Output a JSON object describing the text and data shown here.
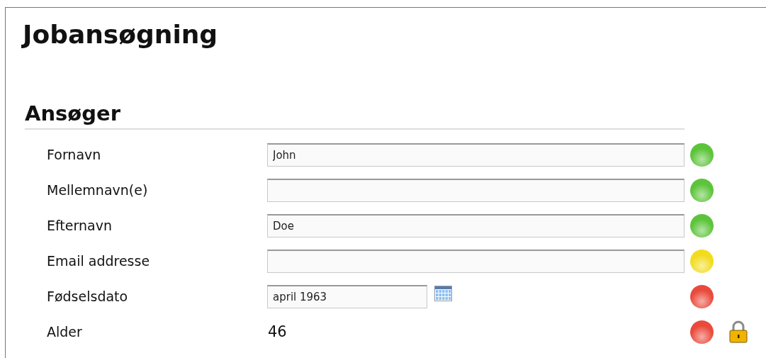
{
  "title": "Jobansøgning",
  "section": {
    "heading": "Ansøger",
    "fields": [
      {
        "kind": "text",
        "label": "Fornavn",
        "value": "John",
        "color": "#5cc43a",
        "locked": false
      },
      {
        "kind": "text",
        "label": "Mellemnavn(e)",
        "color": "#5cc43a",
        "locked": false
      },
      {
        "kind": "text",
        "label": "Efternavn",
        "value": "Doe",
        "color": "#5cc43a",
        "locked": false
      },
      {
        "kind": "text",
        "label": "Email addresse",
        "color": "#f2dc1e",
        "locked": false
      },
      {
        "kind": "date",
        "label": "Fødselsdato",
        "value": "april 1963",
        "color": "#ea4a3c",
        "locked": false
      },
      {
        "kind": "readonly",
        "label": "Alder",
        "value": "46",
        "color": "#ea4a3c",
        "locked": true
      }
    ]
  }
}
